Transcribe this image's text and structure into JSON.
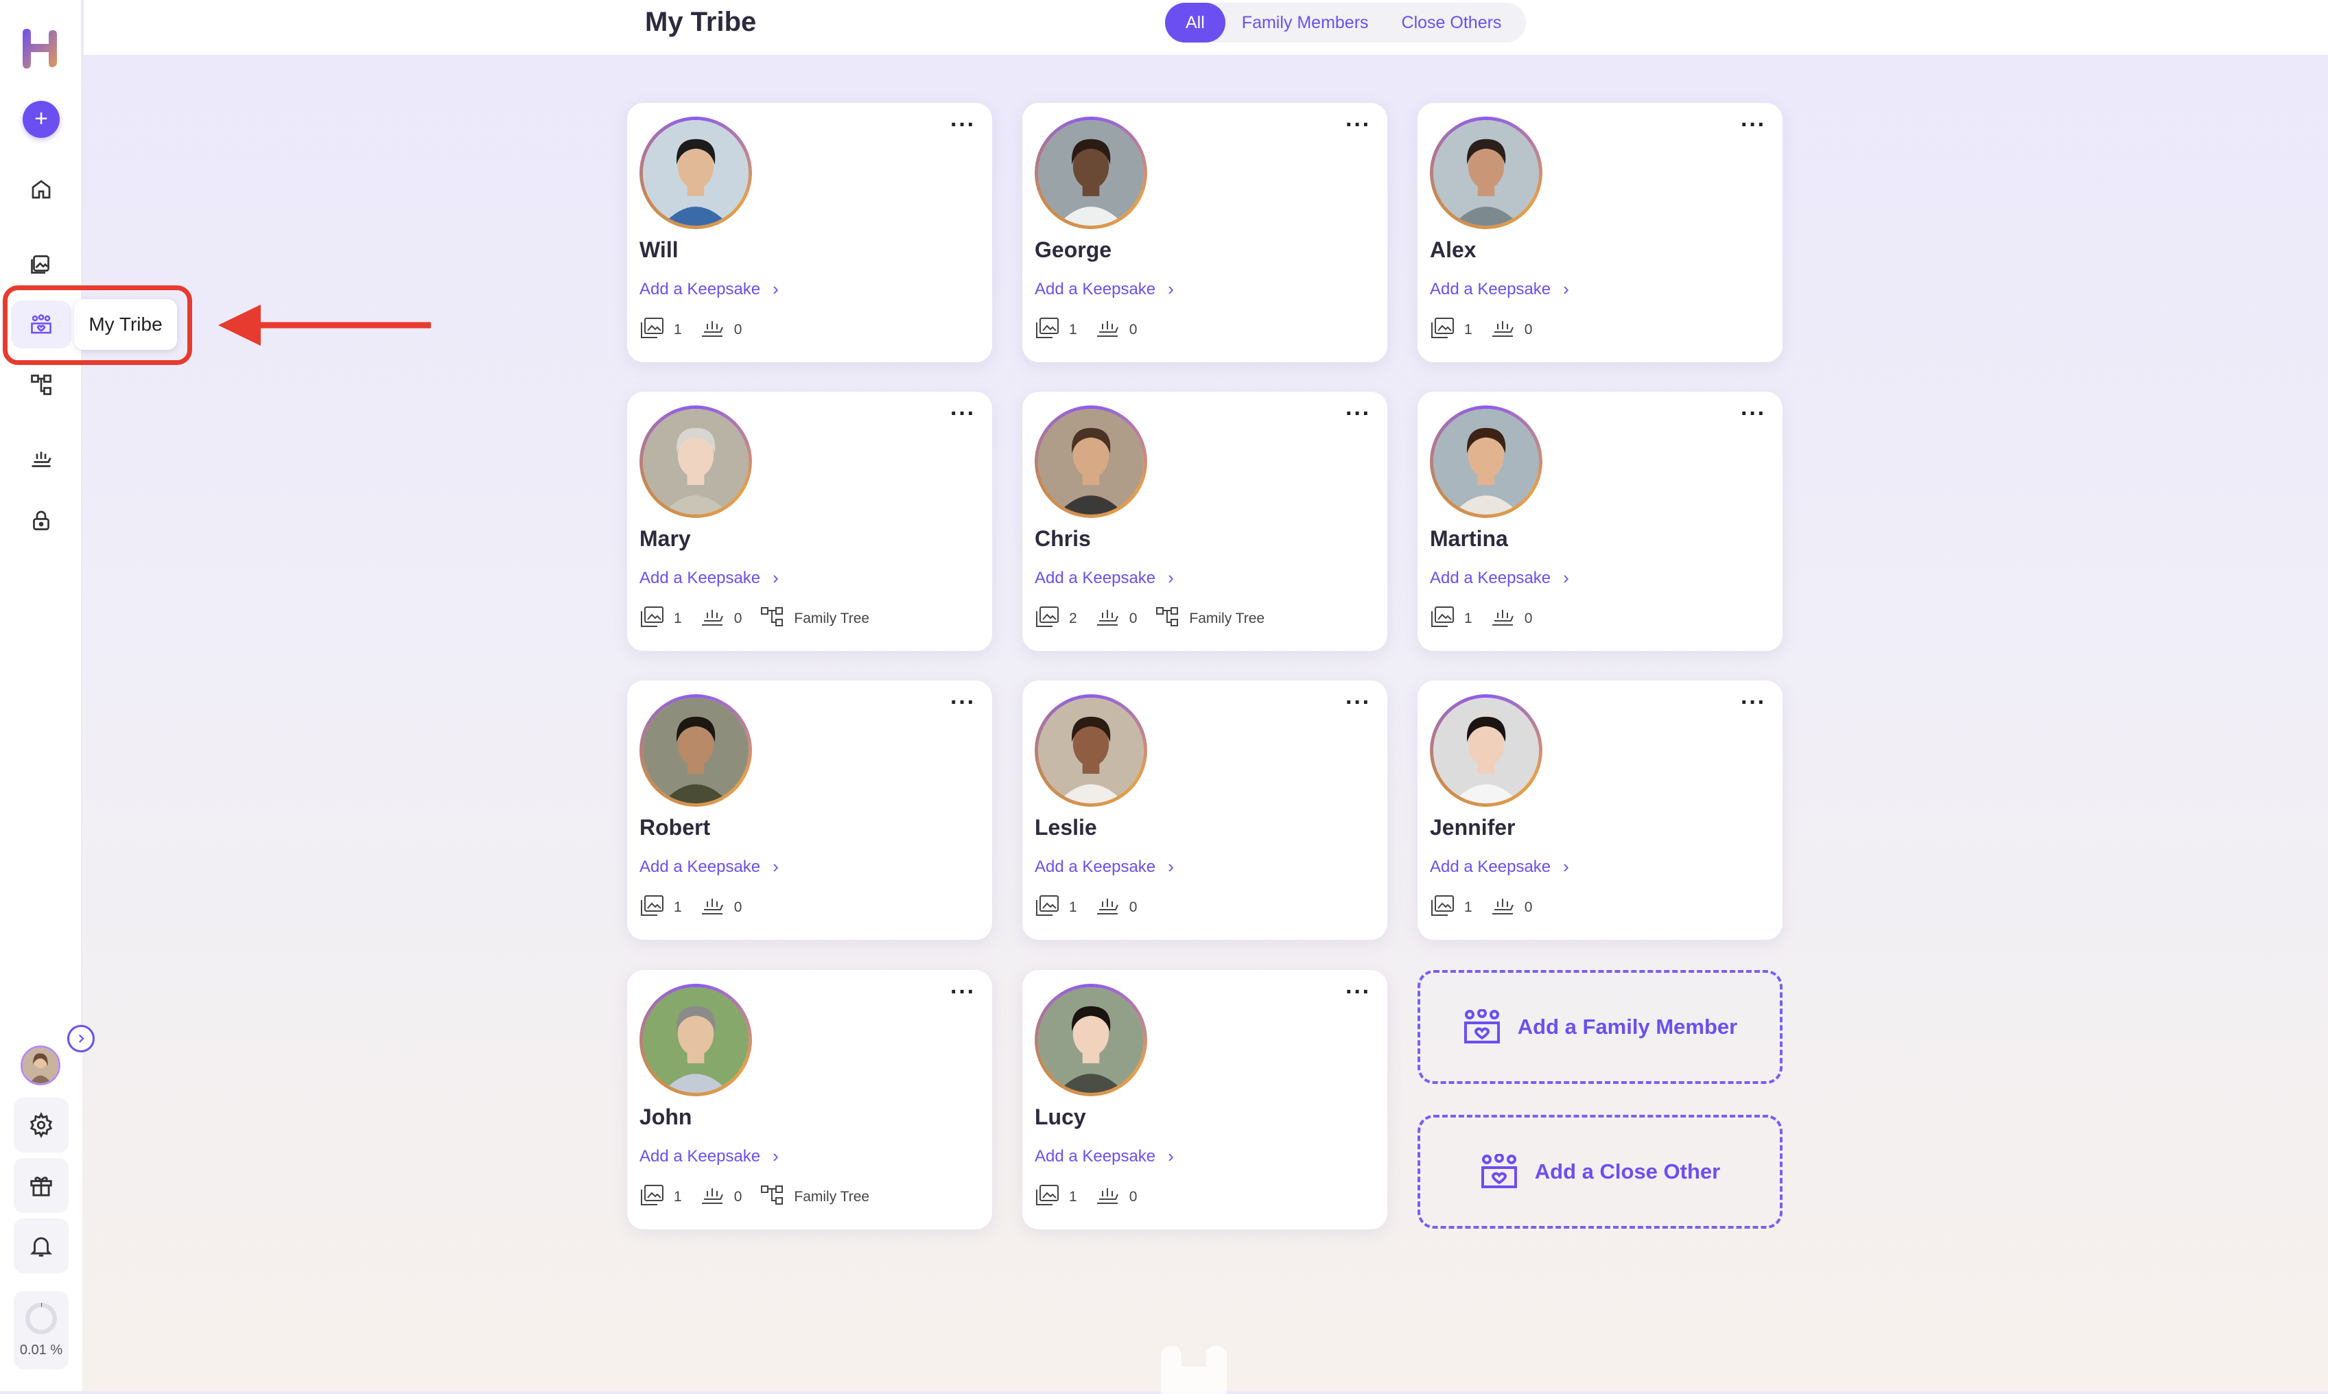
{
  "header": {
    "title": "My Tribe",
    "filters": [
      "All",
      "Family Members",
      "Close Others"
    ],
    "active_filter": "All"
  },
  "sidebar": {
    "tooltip": "My Tribe",
    "storage_percent": "0.01 %",
    "icons": [
      "plus-icon",
      "home-icon",
      "gallery-icon",
      "tribe-icon",
      "family-tree-icon",
      "stories-icon",
      "lock-icon",
      "settings-icon",
      "gift-icon",
      "bell-icon"
    ]
  },
  "cards": [
    {
      "name": "Will",
      "keepsake": "Add a Keepsake",
      "photos": "1",
      "stories": "0",
      "tree": ""
    },
    {
      "name": "George",
      "keepsake": "Add a Keepsake",
      "photos": "1",
      "stories": "0",
      "tree": ""
    },
    {
      "name": "Alex",
      "keepsake": "Add a Keepsake",
      "photos": "1",
      "stories": "0",
      "tree": ""
    },
    {
      "name": "Mary",
      "keepsake": "Add a Keepsake",
      "photos": "1",
      "stories": "0",
      "tree": "Family Tree"
    },
    {
      "name": "Chris",
      "keepsake": "Add a Keepsake",
      "photos": "2",
      "stories": "0",
      "tree": "Family Tree"
    },
    {
      "name": "Martina",
      "keepsake": "Add a Keepsake",
      "photos": "1",
      "stories": "0",
      "tree": ""
    },
    {
      "name": "Robert",
      "keepsake": "Add a Keepsake",
      "photos": "1",
      "stories": "0",
      "tree": ""
    },
    {
      "name": "Leslie",
      "keepsake": "Add a Keepsake",
      "photos": "1",
      "stories": "0",
      "tree": ""
    },
    {
      "name": "Jennifer",
      "keepsake": "Add a Keepsake",
      "photos": "1",
      "stories": "0",
      "tree": ""
    },
    {
      "name": "John",
      "keepsake": "Add a Keepsake",
      "photos": "1",
      "stories": "0",
      "tree": "Family Tree"
    },
    {
      "name": "Lucy",
      "keepsake": "Add a Keepsake",
      "photos": "1",
      "stories": "0",
      "tree": ""
    }
  ],
  "add_actions": {
    "family_member": "Add a Family Member",
    "close_other": "Add a Close Other"
  },
  "colors": {
    "accent": "#6c4ff0",
    "highlight": "#e63b2e"
  }
}
